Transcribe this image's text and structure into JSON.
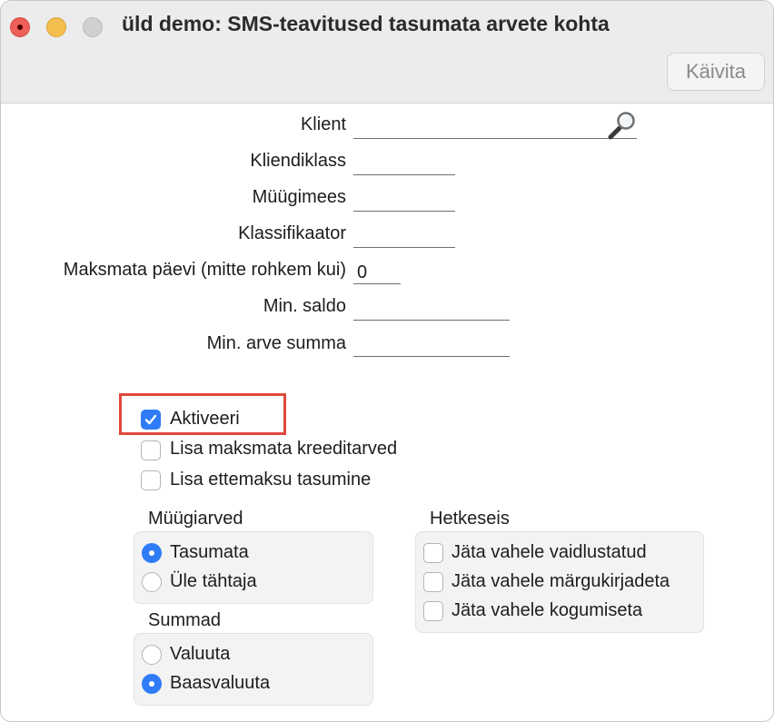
{
  "window": {
    "title": "üld demo: SMS-teavitused tasumata arvete kohta",
    "run_button": "Käivita"
  },
  "form": {
    "client_label": "Klient",
    "client_value": "",
    "client_class_label": "Kliendiklass",
    "client_class_value": "",
    "salesperson_label": "Müügimees",
    "salesperson_value": "",
    "classifier_label": "Klassifikaator",
    "classifier_value": "",
    "unpaid_days_label": "Maksmata päevi (mitte rohkem kui)",
    "unpaid_days_value": "0",
    "min_balance_label": "Min. saldo",
    "min_balance_value": "",
    "min_invoice_label": "Min. arve summa",
    "min_invoice_value": ""
  },
  "options": {
    "activate": {
      "label": "Aktiveeri",
      "checked": true
    },
    "add_credit": {
      "label": "Lisa maksmata kreeditarved",
      "checked": false
    },
    "add_prepayment": {
      "label": "Lisa ettemaksu tasumine",
      "checked": false
    }
  },
  "sales_invoices": {
    "title": "Müügiarved",
    "options": [
      {
        "label": "Tasumata",
        "selected": true
      },
      {
        "label": "Üle tähtaja",
        "selected": false
      }
    ]
  },
  "sums": {
    "title": "Summad",
    "options": [
      {
        "label": "Valuuta",
        "selected": false
      },
      {
        "label": "Baasvaluuta",
        "selected": true
      }
    ]
  },
  "snapshot": {
    "title": "Hetkeseis",
    "options": [
      {
        "label": "Jäta vahele vaidlustatud",
        "checked": false
      },
      {
        "label": "Jäta vahele märgukirjadeta",
        "checked": false
      },
      {
        "label": "Jäta vahele kogumiseta",
        "checked": false
      }
    ]
  },
  "colors": {
    "accent": "#2f7cf6",
    "highlight": "#e0483b"
  }
}
